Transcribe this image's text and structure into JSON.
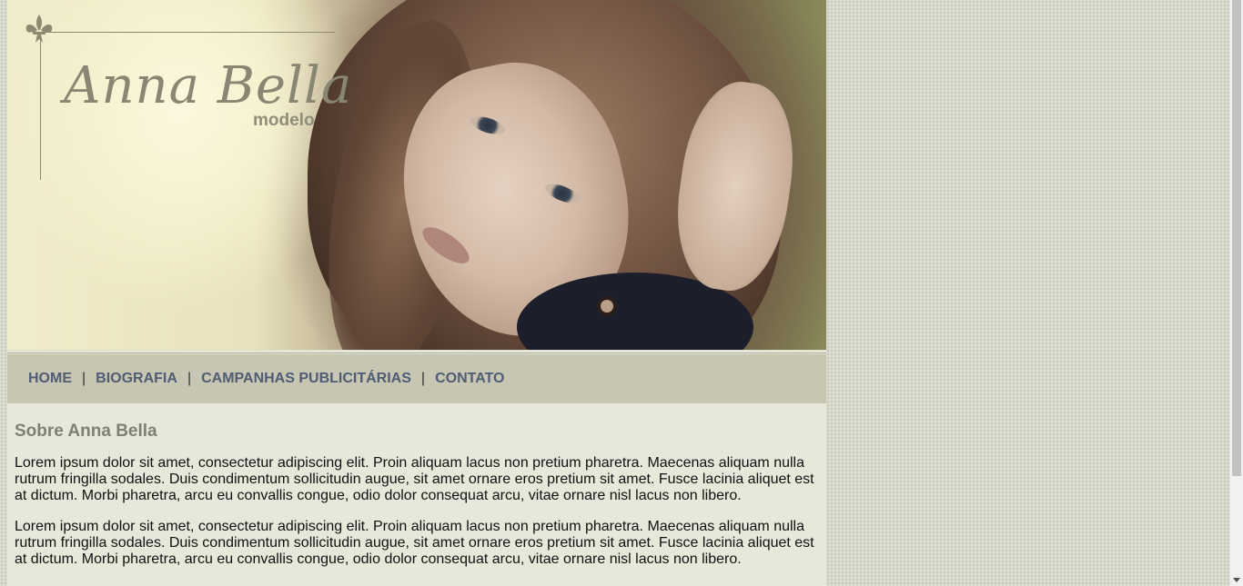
{
  "header": {
    "logo_name": "Anna Bella",
    "logo_subtitle": "modelo",
    "logo_icon": "fleur-de-lis-icon",
    "photo_alt": "hero-photo"
  },
  "nav": {
    "items": [
      {
        "label": "HOME"
      },
      {
        "label": "BIOGRAFIA"
      },
      {
        "label": "CAMPANHAS PUBLICITÁRIAS"
      },
      {
        "label": "CONTATO"
      }
    ],
    "separator": "|"
  },
  "content": {
    "title": "Sobre Anna Bella",
    "paragraphs": [
      "Lorem ipsum dolor sit amet, consectetur adipiscing elit. Proin aliquam lacus non pretium pharetra. Maecenas aliquam nulla rutrum fringilla sodales. Duis condimentum sollicitudin augue, sit amet ornare eros pretium sit amet. Fusce lacinia aliquet est at dictum. Morbi pharetra, arcu eu convallis congue, odio dolor consequat arcu, vitae ornare nisl lacus non libero.",
      "Lorem ipsum dolor sit amet, consectetur adipiscing elit. Proin aliquam lacus non pretium pharetra. Maecenas aliquam nulla rutrum fringilla sodales. Duis condimentum sollicitudin augue, sit amet ornare eros pretium sit amet. Fusce lacinia aliquet est at dictum. Morbi pharetra, arcu eu convallis congue, odio dolor consequat arcu, vitae ornare nisl lacus non libero."
    ]
  },
  "colors": {
    "nav_link": "#4f5c73",
    "nav_bg": "#c6c6b2",
    "content_bg": "#e7e7da",
    "title": "#7f7f73",
    "page_bg": "#d6d7c8"
  }
}
